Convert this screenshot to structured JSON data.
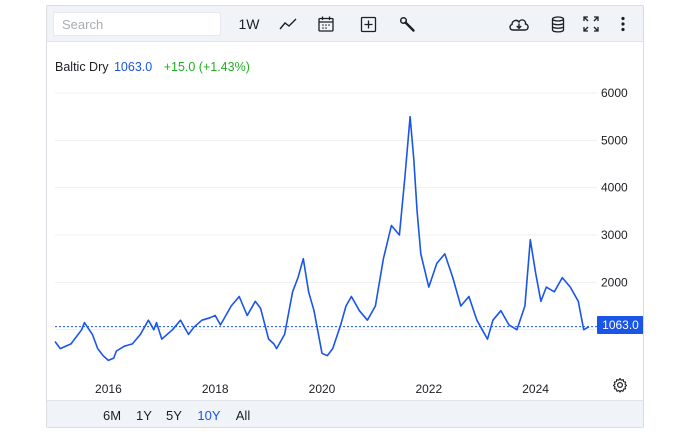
{
  "toolbar": {
    "search_placeholder": "Search",
    "interval_label": "1W",
    "icons": [
      "line-chart-icon",
      "calendar-icon",
      "plus-square-icon",
      "wrench-icon",
      "cloud-download-icon",
      "database-icon",
      "fullscreen-icon",
      "more-vertical-icon"
    ]
  },
  "legend": {
    "name": "Baltic Dry",
    "price": "1063.0",
    "change": "+15.0 (+1.43%)"
  },
  "price_tag": "1063.0",
  "range_buttons": [
    "6M",
    "1Y",
    "5Y",
    "10Y",
    "All"
  ],
  "active_range": "10Y",
  "colors": {
    "line": "#1a55e8",
    "positive": "#22b021",
    "toolbar_bg": "#f0f3f7",
    "grid": "#edeff2"
  },
  "chart_data": {
    "type": "line",
    "title": "",
    "xlabel": "",
    "ylabel": "",
    "ylim": [
      0,
      6000
    ],
    "y_ticks": [
      "6000",
      "5000",
      "4000",
      "3000",
      "2000",
      "1000"
    ],
    "x_ticks": [
      "2016",
      "2018",
      "2020",
      "2022",
      "2024"
    ],
    "grid": true,
    "series": [
      {
        "name": "Baltic Dry",
        "x": [
          2015.0,
          2015.1,
          2015.3,
          2015.5,
          2015.55,
          2015.7,
          2015.8,
          2015.9,
          2016.0,
          2016.1,
          2016.15,
          2016.3,
          2016.45,
          2016.6,
          2016.75,
          2016.85,
          2016.9,
          2017.0,
          2017.2,
          2017.35,
          2017.5,
          2017.6,
          2017.75,
          2017.9,
          2018.0,
          2018.1,
          2018.3,
          2018.45,
          2018.6,
          2018.75,
          2018.85,
          2019.0,
          2019.1,
          2019.15,
          2019.3,
          2019.45,
          2019.55,
          2019.65,
          2019.75,
          2019.85,
          2020.0,
          2020.1,
          2020.2,
          2020.35,
          2020.45,
          2020.55,
          2020.7,
          2020.85,
          2021.0,
          2021.15,
          2021.3,
          2021.45,
          2021.55,
          2021.65,
          2021.72,
          2021.78,
          2021.85,
          2022.0,
          2022.15,
          2022.3,
          2022.45,
          2022.6,
          2022.75,
          2022.9,
          2023.0,
          2023.1,
          2023.2,
          2023.35,
          2023.5,
          2023.65,
          2023.8,
          2023.9,
          2024.0,
          2024.1,
          2024.2,
          2024.35,
          2024.5,
          2024.65,
          2024.8,
          2024.9,
          2025.0
        ],
        "values": [
          750,
          600,
          700,
          1000,
          1150,
          900,
          600,
          450,
          350,
          400,
          550,
          650,
          700,
          900,
          1200,
          1000,
          1150,
          800,
          1000,
          1200,
          900,
          1050,
          1200,
          1250,
          1300,
          1100,
          1500,
          1700,
          1300,
          1600,
          1450,
          800,
          700,
          600,
          900,
          1800,
          2100,
          2500,
          1800,
          1400,
          500,
          450,
          600,
          1100,
          1500,
          1700,
          1400,
          1200,
          1500,
          2500,
          3200,
          3000,
          4200,
          5500,
          4600,
          3500,
          2600,
          1900,
          2400,
          2600,
          2100,
          1500,
          1700,
          1200,
          1000,
          800,
          1200,
          1400,
          1100,
          1000,
          1500,
          2900,
          2200,
          1600,
          1900,
          1800,
          2100,
          1900,
          1600,
          1000,
          1063
        ]
      }
    ],
    "last_value": 1063.0
  }
}
